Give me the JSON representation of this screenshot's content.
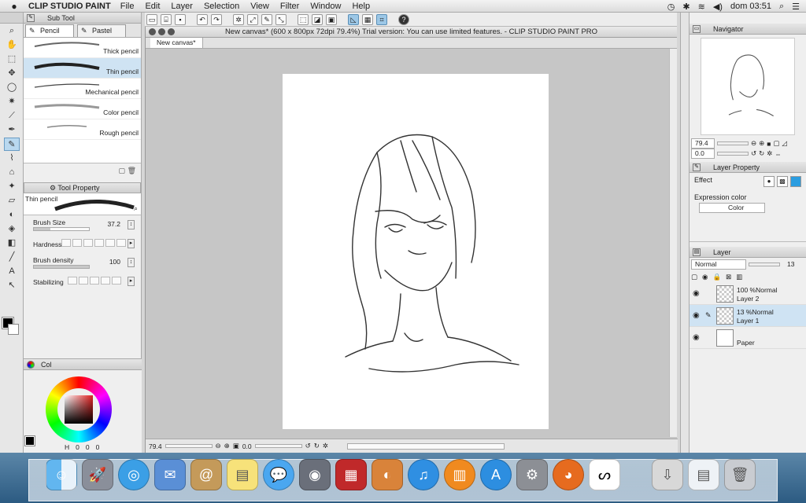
{
  "menubar": {
    "app_name": "CLIP STUDIO PAINT",
    "items": [
      "File",
      "Edit",
      "Layer",
      "Selection",
      "View",
      "Filter",
      "Window",
      "Help"
    ],
    "clock": "dom 03:51"
  },
  "subtool": {
    "title": "Sub Tool",
    "tabs": [
      "Pencil",
      "Pastel"
    ],
    "brushes": [
      "Thick pencil",
      "Thin pencil",
      "Mechanical pencil",
      "Color pencil",
      "Rough pencil"
    ],
    "selected_index": 1
  },
  "tool_property": {
    "title": "Tool Property",
    "brush_name": "Thin pencil",
    "props": [
      {
        "label": "Brush Size",
        "value": "37.2"
      },
      {
        "label": "Hardness",
        "value": ""
      },
      {
        "label": "Brush density",
        "value": "100"
      },
      {
        "label": "Stabilizing",
        "value": ""
      }
    ]
  },
  "color": {
    "tab_label": "Col",
    "values": [
      "H",
      "0",
      "0",
      "0"
    ]
  },
  "document": {
    "title": "New canvas* (600 x 800px 72dpi 79.4%)  Trial version: You can use limited features. - CLIP STUDIO PAINT PRO",
    "tab": "New canvas*",
    "zoom": "79.4",
    "rotation": "0.0"
  },
  "navigator": {
    "title": "Navigator",
    "zoom": "79.4",
    "rotation": "0.0"
  },
  "layer_property": {
    "title": "Layer Property",
    "effect_label": "Effect",
    "expression_label": "Expression color",
    "expression_value": "Color"
  },
  "layers": {
    "title": "Layer",
    "blend_mode": "Normal",
    "opacity": "13",
    "items": [
      {
        "opacity": "100 %Normal",
        "name": "Layer 2"
      },
      {
        "opacity": "13 %Normal",
        "name": "Layer 1"
      },
      {
        "opacity": "",
        "name": "Paper"
      }
    ]
  }
}
